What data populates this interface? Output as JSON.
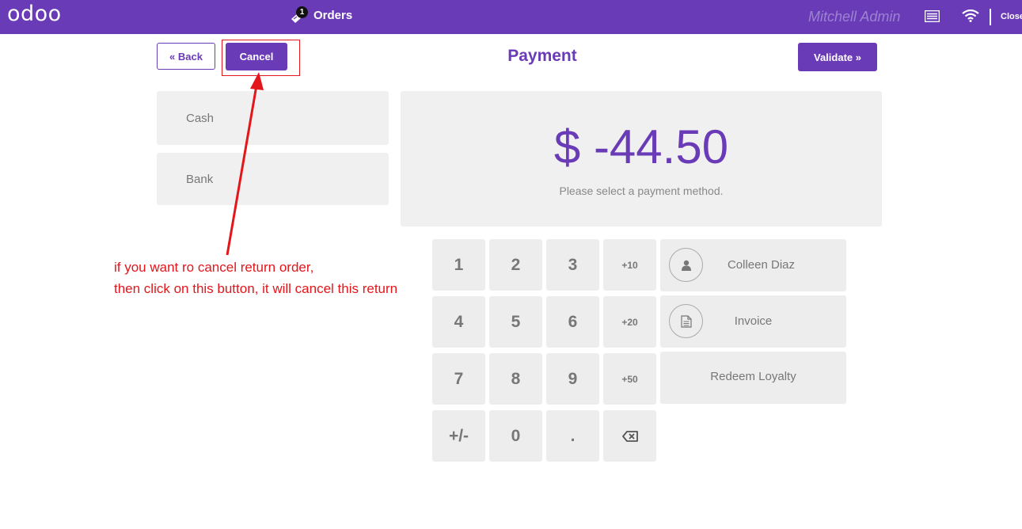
{
  "topbar": {
    "logo": "odoo",
    "orders_label": "Orders",
    "orders_count": "1",
    "cashier": "Mitchell Admin",
    "close_label": "Close"
  },
  "header": {
    "back_label": "« Back",
    "cancel_label": "Cancel",
    "title": "Payment",
    "validate_label": "Validate »"
  },
  "payment_methods": [
    "Cash",
    "Bank"
  ],
  "amount": {
    "value": "$ -44.50",
    "message": "Please select a payment method."
  },
  "numpad": {
    "keys": [
      "1",
      "2",
      "3",
      "+10",
      "4",
      "5",
      "6",
      "+20",
      "7",
      "8",
      "9",
      "+50",
      "+/-",
      "0",
      ".",
      "backspace"
    ]
  },
  "side_buttons": {
    "customer": "Colleen Diaz",
    "invoice": "Invoice",
    "loyalty": "Redeem Loyalty"
  },
  "annotation": {
    "line1": "if you want ro cancel return order,",
    "line2": "then click on this button, it will cancel this return"
  },
  "colors": {
    "brand": "#6a3bb6",
    "annotation": "#e3161b",
    "panel": "#f0f0f0"
  }
}
